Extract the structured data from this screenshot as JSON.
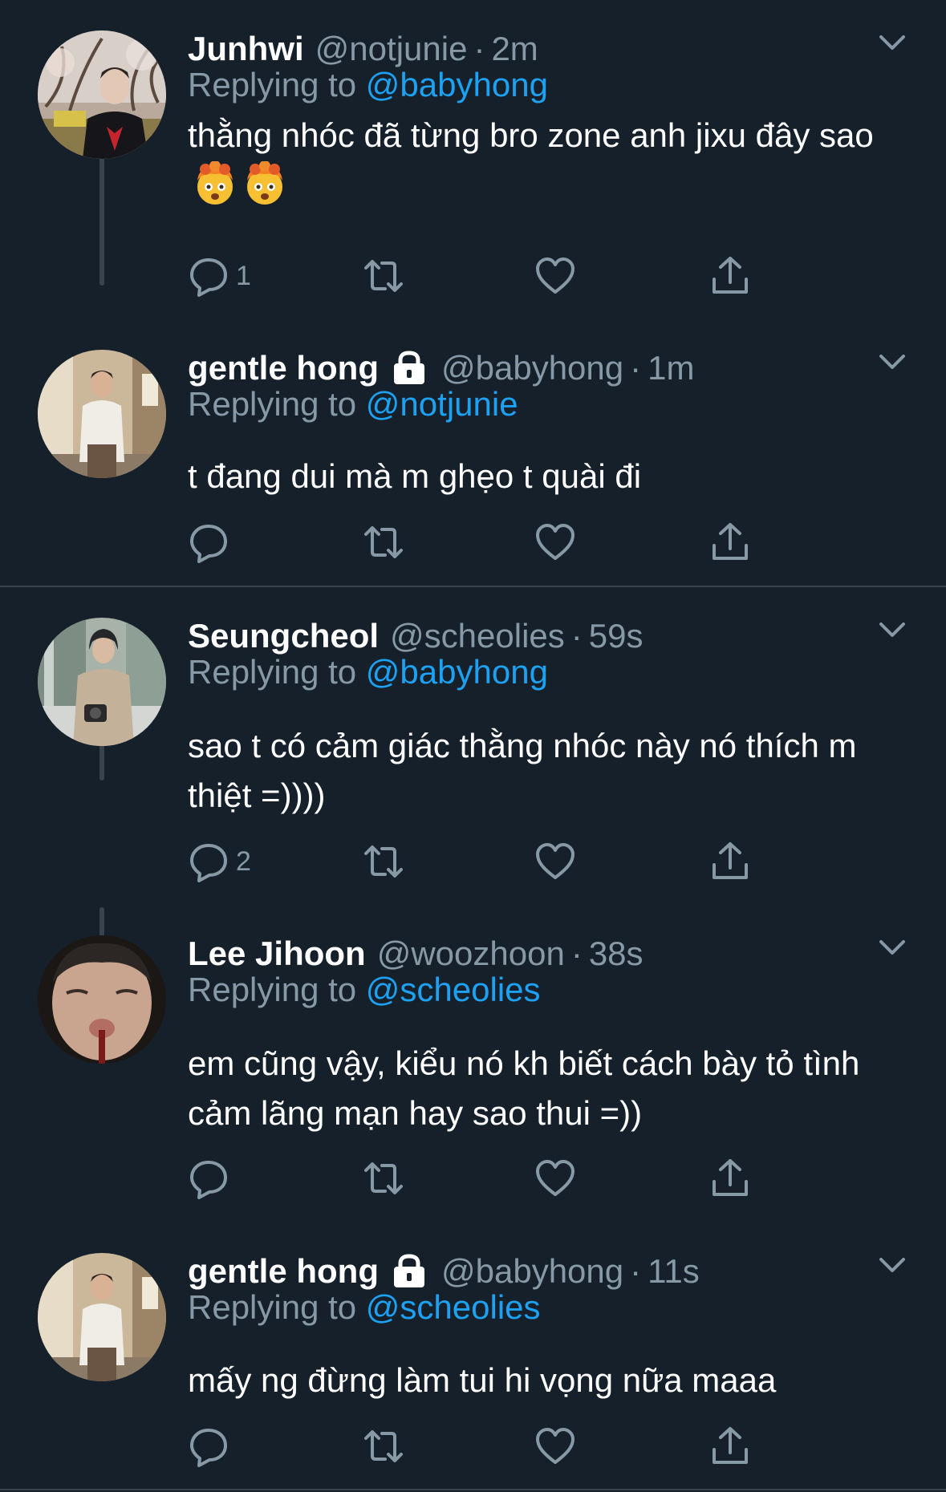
{
  "reply_prefix": "Replying to ",
  "tweets": [
    {
      "name": "Junhwi",
      "handle": "@notjunie",
      "time": "2m",
      "reply_to": "@babyhong",
      "text": "thằng nhóc đã từng bro zone anh jixu đây sao",
      "emoji": [
        "exploding-head",
        "exploding-head"
      ],
      "reply_count": "1",
      "locked": false,
      "avatar_desc": "person-under-cherry-blossom"
    },
    {
      "name": "gentle hong",
      "handle": "@babyhong",
      "time": "1m",
      "reply_to": "@notjunie",
      "text": "t đang dui mà m ghẹo t quài đi",
      "emoji": [],
      "reply_count": "",
      "locked": true,
      "avatar_desc": "man-in-white-shirt-street"
    },
    {
      "name": "Seungcheol",
      "handle": "@scheolies",
      "time": "59s",
      "reply_to": "@babyhong",
      "text": "sao t có cảm giác thằng nhóc này nó thích m thiệt =))))",
      "emoji": [],
      "reply_count": "2",
      "locked": false,
      "avatar_desc": "man-with-camera-city"
    },
    {
      "name": "Lee Jihoon",
      "handle": "@woozhoon",
      "time": "38s",
      "reply_to": "@scheolies",
      "text": "em cũng vậy, kiểu nó kh biết cách bày tỏ tình cảm lãng mạn hay sao thui =))",
      "emoji": [],
      "reply_count": "",
      "locked": false,
      "avatar_desc": "close-up-face-with-straw"
    },
    {
      "name": "gentle hong",
      "handle": "@babyhong",
      "time": "11s",
      "reply_to": "@scheolies",
      "text": "mấy ng đừng làm tui hi vọng nữa maaa",
      "emoji": [],
      "reply_count": "",
      "locked": true,
      "avatar_desc": "man-in-white-shirt-street"
    }
  ],
  "colors": {
    "background": "#15202b",
    "text": "#ffffff",
    "secondary": "#8899a6",
    "link": "#1da1f2",
    "divider": "#38444d"
  }
}
